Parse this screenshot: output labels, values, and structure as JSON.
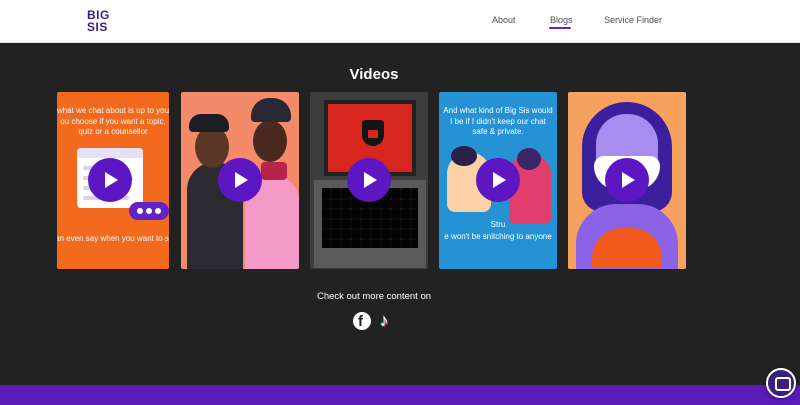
{
  "header": {
    "logo_line1": "BIG",
    "logo_line2": "SIS",
    "nav": [
      {
        "label": "About"
      },
      {
        "label": "Blogs",
        "active": true
      },
      {
        "label": "Service Finder"
      }
    ],
    "accent_color": "#6a1fc7"
  },
  "videos": {
    "title": "Videos",
    "cards": [
      {
        "top_text": [
          "what we chat about is up to you",
          "ou choose if you want a topic,",
          "quiz or a counsellor"
        ],
        "bottom_text": "an even say when you want to s"
      },
      {},
      {},
      {
        "top_text": [
          "And what kind of Big Sis would",
          "I be if I didn't keep our chat",
          "safe & private."
        ],
        "mid_text": "Stru",
        "bottom_text": "e won't be snitching to anyone"
      },
      {}
    ],
    "play_icon": "play-icon",
    "play_color": "#5d17c2"
  },
  "social": {
    "text": "Check out more content on",
    "facebook_glyph": "f",
    "tiktok_glyph": "♪"
  },
  "colors": {
    "background": "#222222",
    "footer": "#5a1bb8"
  }
}
